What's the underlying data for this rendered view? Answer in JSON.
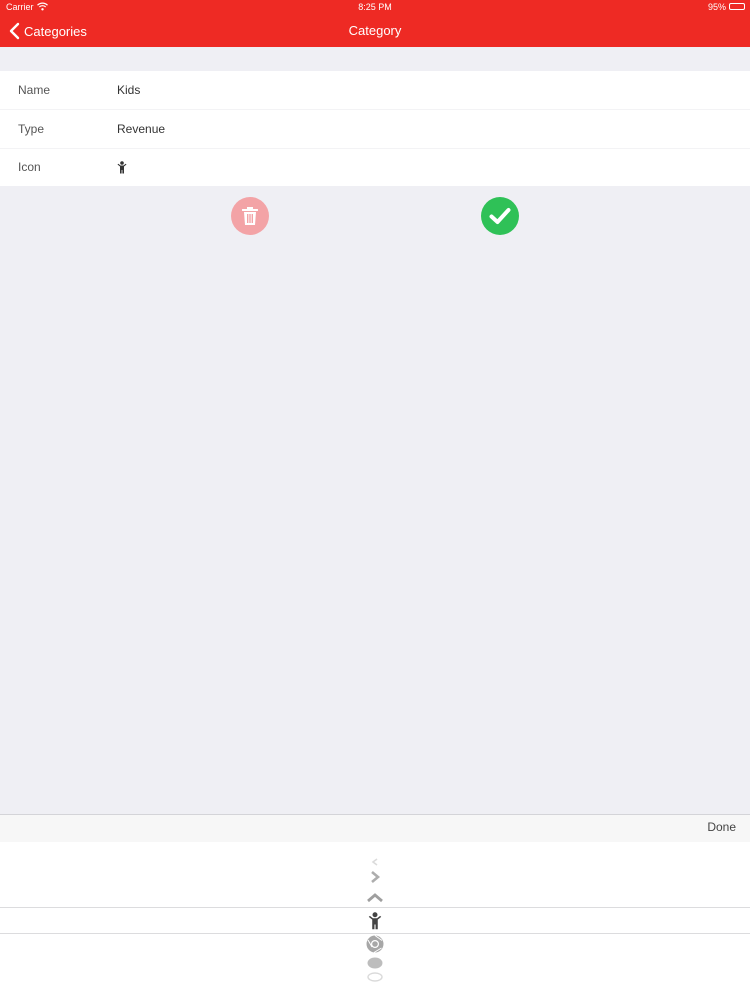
{
  "status_bar": {
    "carrier": "Carrier",
    "time": "8:25 PM",
    "battery": "95%",
    "battery_level": 0.95
  },
  "nav": {
    "back_label": "Categories",
    "title": "Category"
  },
  "form": {
    "rows": [
      {
        "label": "Name",
        "value": "Kids"
      },
      {
        "label": "Type",
        "value": "Revenue"
      },
      {
        "label": "Icon",
        "value_icon": "child-icon"
      }
    ]
  },
  "actions": {
    "delete_icon": "trash-icon",
    "confirm_icon": "checkmark-icon",
    "colors": {
      "delete": "#f3a3a6",
      "confirm": "#2fc157"
    }
  },
  "picker": {
    "done_label": "Done",
    "options": [
      "chevron-left-icon",
      "chevron-right-icon",
      "chevron-up-icon",
      "child-icon",
      "chrome-icon",
      "circle-icon",
      "circle-outline-icon"
    ],
    "selected": "child-icon"
  },
  "accent_color": "#ee2a24"
}
